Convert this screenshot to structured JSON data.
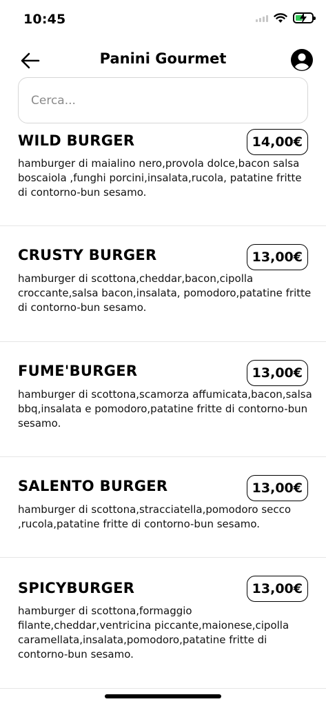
{
  "status_bar": {
    "time": "10:45"
  },
  "header": {
    "title": "Panini Gourmet"
  },
  "search": {
    "placeholder": "Cerca..."
  },
  "menu": [
    {
      "name": "WILD BURGER",
      "price": "14,00€",
      "description": "hamburger di maialino nero,provola dolce,bacon salsa boscaiola ,funghi porcini,insalata,rucola, patatine fritte di contorno-bun sesamo."
    },
    {
      "name": "CRUSTY BURGER",
      "price": "13,00€",
      "description": "hamburger di scottona,cheddar,bacon,cipolla croccante,salsa bacon,insalata, pomodoro,patatine fritte  di contorno-bun sesamo."
    },
    {
      "name": "FUME'BURGER",
      "price": "13,00€",
      "description": "hamburger di scottona,scamorza affumicata,bacon,salsa bbq,insalata e pomodoro,patatine fritte di contorno-bun sesamo."
    },
    {
      "name": "SALENTO BURGER",
      "price": "13,00€",
      "description": "hamburger di scottona,stracciatella,pomodoro secco ,rucola,patatine fritte di contorno-bun sesamo."
    },
    {
      "name": "SPICYBURGER",
      "price": "13,00€",
      "description": "hamburger di scottona,formaggio filante,cheddar,ventricina piccante,maionese,cipolla caramellata,insalata,pomodoro,patatine fritte  di contorno-bun sesamo."
    }
  ],
  "colors": {
    "battery": "#34c759",
    "divider": "#e6e6e6",
    "search_border": "#d6d6d6"
  },
  "icons": [
    "signal-icon",
    "wifi-icon",
    "battery-icon",
    "back-arrow-icon",
    "profile-icon"
  ]
}
